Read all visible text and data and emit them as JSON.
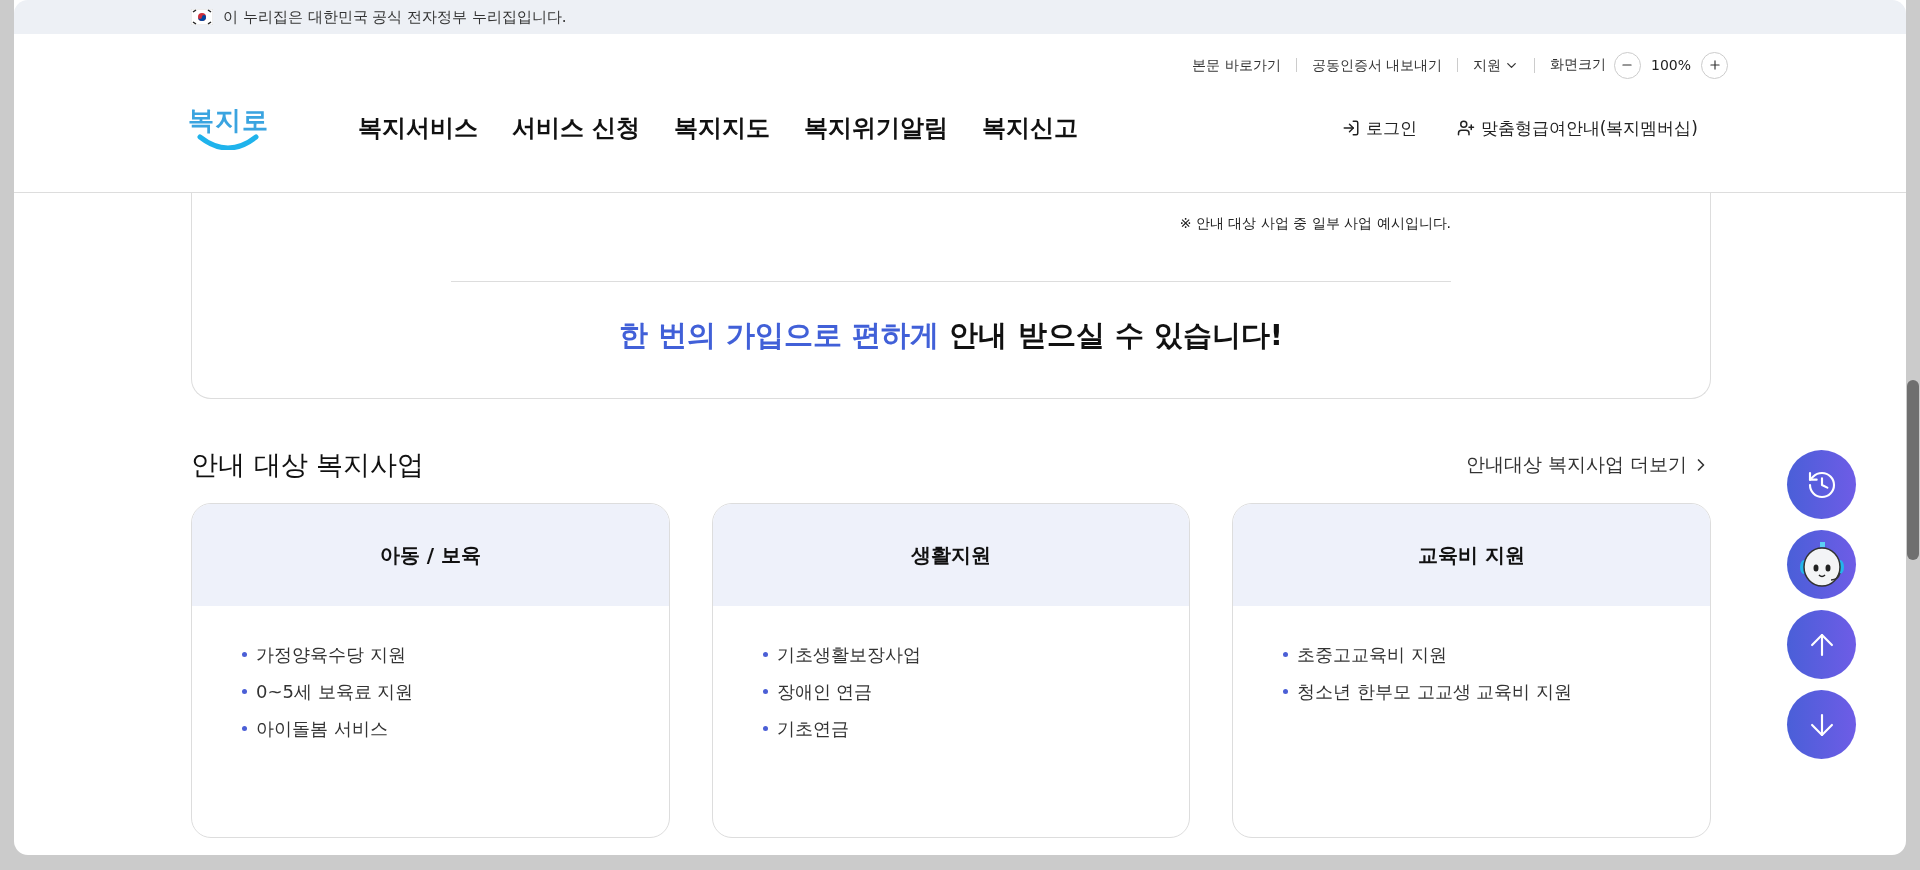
{
  "banner": {
    "text": "이 누리집은 대한민국 공식 전자정부 누리집입니다."
  },
  "utility_links": [
    {
      "label": "본문 바로가기",
      "kind": "link"
    },
    {
      "label": "공동인증서 내보내기",
      "kind": "link"
    },
    {
      "label": "지원",
      "kind": "dropdown"
    }
  ],
  "zoom": {
    "label": "화면크기",
    "value": "100%"
  },
  "logo": {
    "text": "복지로"
  },
  "nav": [
    "복지서비스",
    "서비스 신청",
    "복지지도",
    "복지위기알림",
    "복지신고"
  ],
  "account": [
    {
      "label": "로그인",
      "kind": "login"
    },
    {
      "label": "맞춤형급여안내(복지멤버십)",
      "kind": "member"
    }
  ],
  "intro": {
    "note": "※ 안내 대상 사업 중 일부 사업 예시입니다.",
    "headline_highlight": "한 번의 가입으로 편하게",
    "headline_rest": "안내 받으실 수 있습니다!"
  },
  "section": {
    "title": "안내 대상 복지사업",
    "more_link": "안내대상 복지사업 더보기"
  },
  "cards": [
    {
      "title": "아동 / 보육",
      "items": [
        "가정양육수당 지원",
        "0~5세 보육료 지원",
        "아이돌봄 서비스"
      ]
    },
    {
      "title": "생활지원",
      "items": [
        "기초생활보장사업",
        "장애인 연금",
        "기초연금"
      ]
    },
    {
      "title": "교육비 지원",
      "items": [
        "초중고교육비 지원",
        "청소년 한부모 고교생 교육비 지원"
      ]
    }
  ],
  "floating_buttons": [
    {
      "kind": "history"
    },
    {
      "kind": "chatbot"
    },
    {
      "kind": "top"
    },
    {
      "kind": "bottom"
    }
  ]
}
